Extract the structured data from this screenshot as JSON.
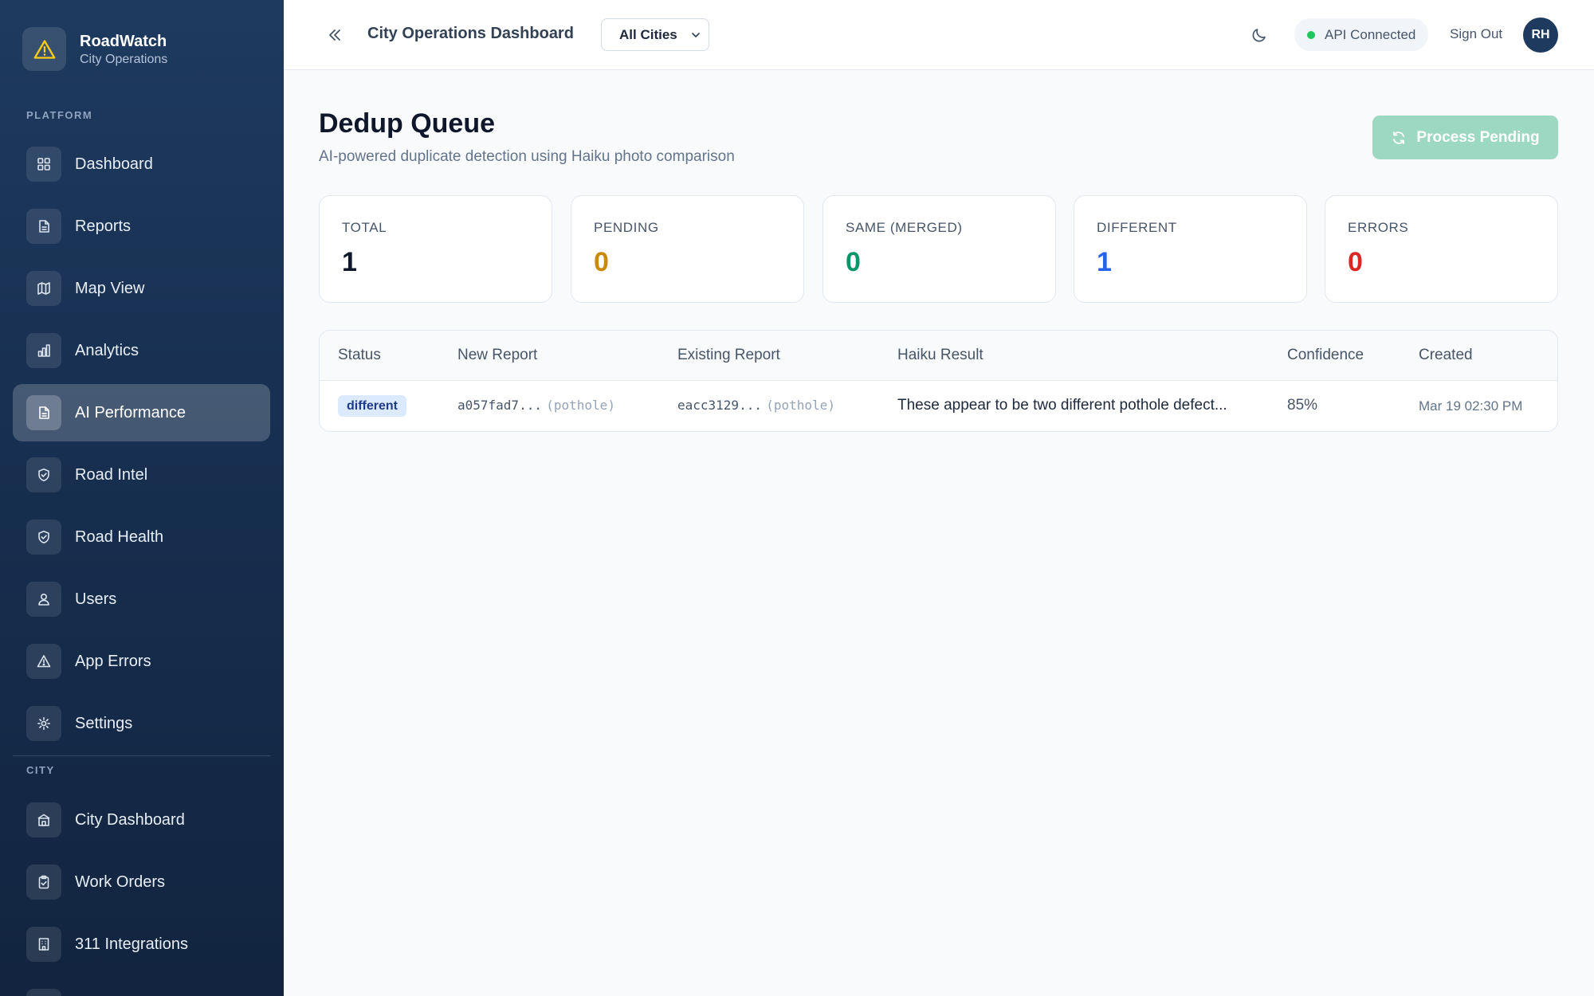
{
  "brand": {
    "name": "RoadWatch",
    "subtitle": "City Operations"
  },
  "sidebar": {
    "platform_label": "PLATFORM",
    "city_label": "CITY",
    "platform_items": [
      {
        "label": "Dashboard",
        "icon": "grid-icon"
      },
      {
        "label": "Reports",
        "icon": "document-icon"
      },
      {
        "label": "Map View",
        "icon": "map-icon"
      },
      {
        "label": "Analytics",
        "icon": "bar-chart-icon"
      },
      {
        "label": "AI Performance",
        "icon": "document-icon",
        "active": true
      },
      {
        "label": "Road Intel",
        "icon": "shield-check-icon"
      },
      {
        "label": "Road Health",
        "icon": "shield-check-icon"
      },
      {
        "label": "Users",
        "icon": "users-icon"
      },
      {
        "label": "App Errors",
        "icon": "warning-icon"
      },
      {
        "label": "Settings",
        "icon": "gear-icon"
      }
    ],
    "city_items": [
      {
        "label": "City Dashboard",
        "icon": "building-icon"
      },
      {
        "label": "Work Orders",
        "icon": "clipboard-check-icon"
      },
      {
        "label": "311 Integrations",
        "icon": "office-icon"
      }
    ]
  },
  "topbar": {
    "title": "City Operations Dashboard",
    "city_select": "All Cities",
    "api_status": "API Connected",
    "sign_out": "Sign Out",
    "avatar_initials": "RH"
  },
  "page": {
    "title": "Dedup Queue",
    "subtitle": "AI-powered duplicate detection using Haiku photo comparison",
    "process_button": "Process Pending"
  },
  "stats": [
    {
      "label": "TOTAL",
      "value": "1",
      "color": "#0f172a"
    },
    {
      "label": "PENDING",
      "value": "0",
      "color": "#ca8a04"
    },
    {
      "label": "SAME (MERGED)",
      "value": "0",
      "color": "#059669"
    },
    {
      "label": "DIFFERENT",
      "value": "1",
      "color": "#2563eb"
    },
    {
      "label": "ERRORS",
      "value": "0",
      "color": "#dc2626"
    }
  ],
  "table": {
    "columns": [
      "Status",
      "New Report",
      "Existing Report",
      "Haiku Result",
      "Confidence",
      "Created"
    ],
    "rows": [
      {
        "status": "different",
        "new_id": "a057fad7...",
        "new_type": "(pothole)",
        "existing_id": "eacc3129...",
        "existing_type": "(pothole)",
        "result": "These appear to be two different pothole defect...",
        "confidence": "85%",
        "created": "Mar 19 02:30 PM"
      }
    ]
  },
  "colors": {
    "accent": "#1e3a5f",
    "success": "#22c55e",
    "process_button": "#9dd8c3"
  }
}
